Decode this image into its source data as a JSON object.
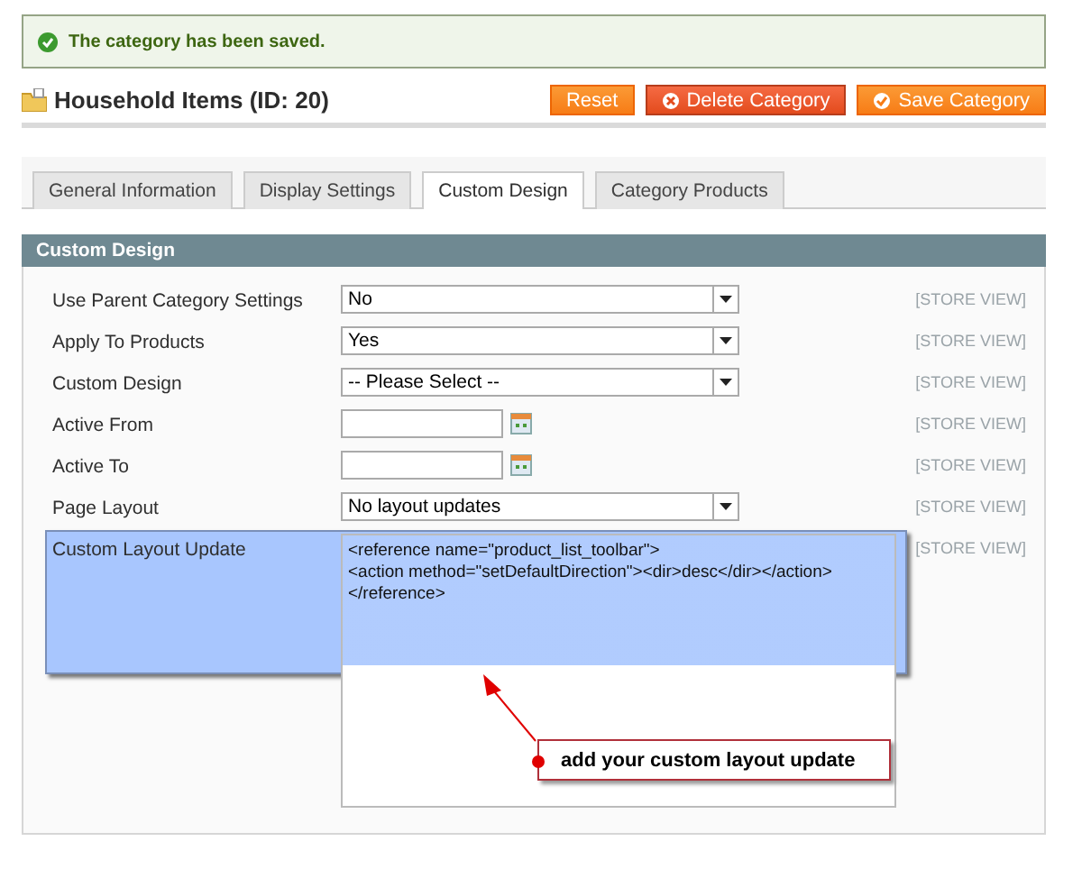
{
  "message": {
    "text": "The category has been saved."
  },
  "page": {
    "title": "Household Items (ID: 20)"
  },
  "buttons": [
    {
      "label": "Reset",
      "kind": "plain"
    },
    {
      "label": "Delete Category",
      "kind": "delete"
    },
    {
      "label": "Save Category",
      "kind": "save"
    }
  ],
  "tabs": [
    {
      "label": "General Information",
      "selected": false
    },
    {
      "label": "Display Settings",
      "selected": false
    },
    {
      "label": "Custom Design",
      "selected": true
    },
    {
      "label": "Category Products",
      "selected": false
    }
  ],
  "section": {
    "title": "Custom Design"
  },
  "fields": [
    {
      "label": "Use Parent Category Settings",
      "kind": "select",
      "value": "No",
      "scope": "[STORE VIEW]"
    },
    {
      "label": "Apply To Products",
      "kind": "select",
      "value": "Yes",
      "scope": "[STORE VIEW]"
    },
    {
      "label": "Custom Design",
      "kind": "select",
      "value": "-- Please Select --",
      "scope": "[STORE VIEW]"
    },
    {
      "label": "Active From",
      "kind": "date",
      "scope": "[STORE VIEW]"
    },
    {
      "label": "Active To",
      "kind": "date",
      "scope": "[STORE VIEW]"
    },
    {
      "label": "Page Layout",
      "kind": "select",
      "value": "No layout updates",
      "scope": "[STORE VIEW]"
    },
    {
      "label": "Custom Layout Update",
      "kind": "textarea",
      "lines": [
        "<reference name=\"product_list_toolbar\">",
        "<action method=\"setDefaultDirection\"><dir>desc</dir></action>",
        "</reference>"
      ],
      "scope": "[STORE VIEW]"
    }
  ],
  "annotation": {
    "text": "add your custom layout update"
  }
}
